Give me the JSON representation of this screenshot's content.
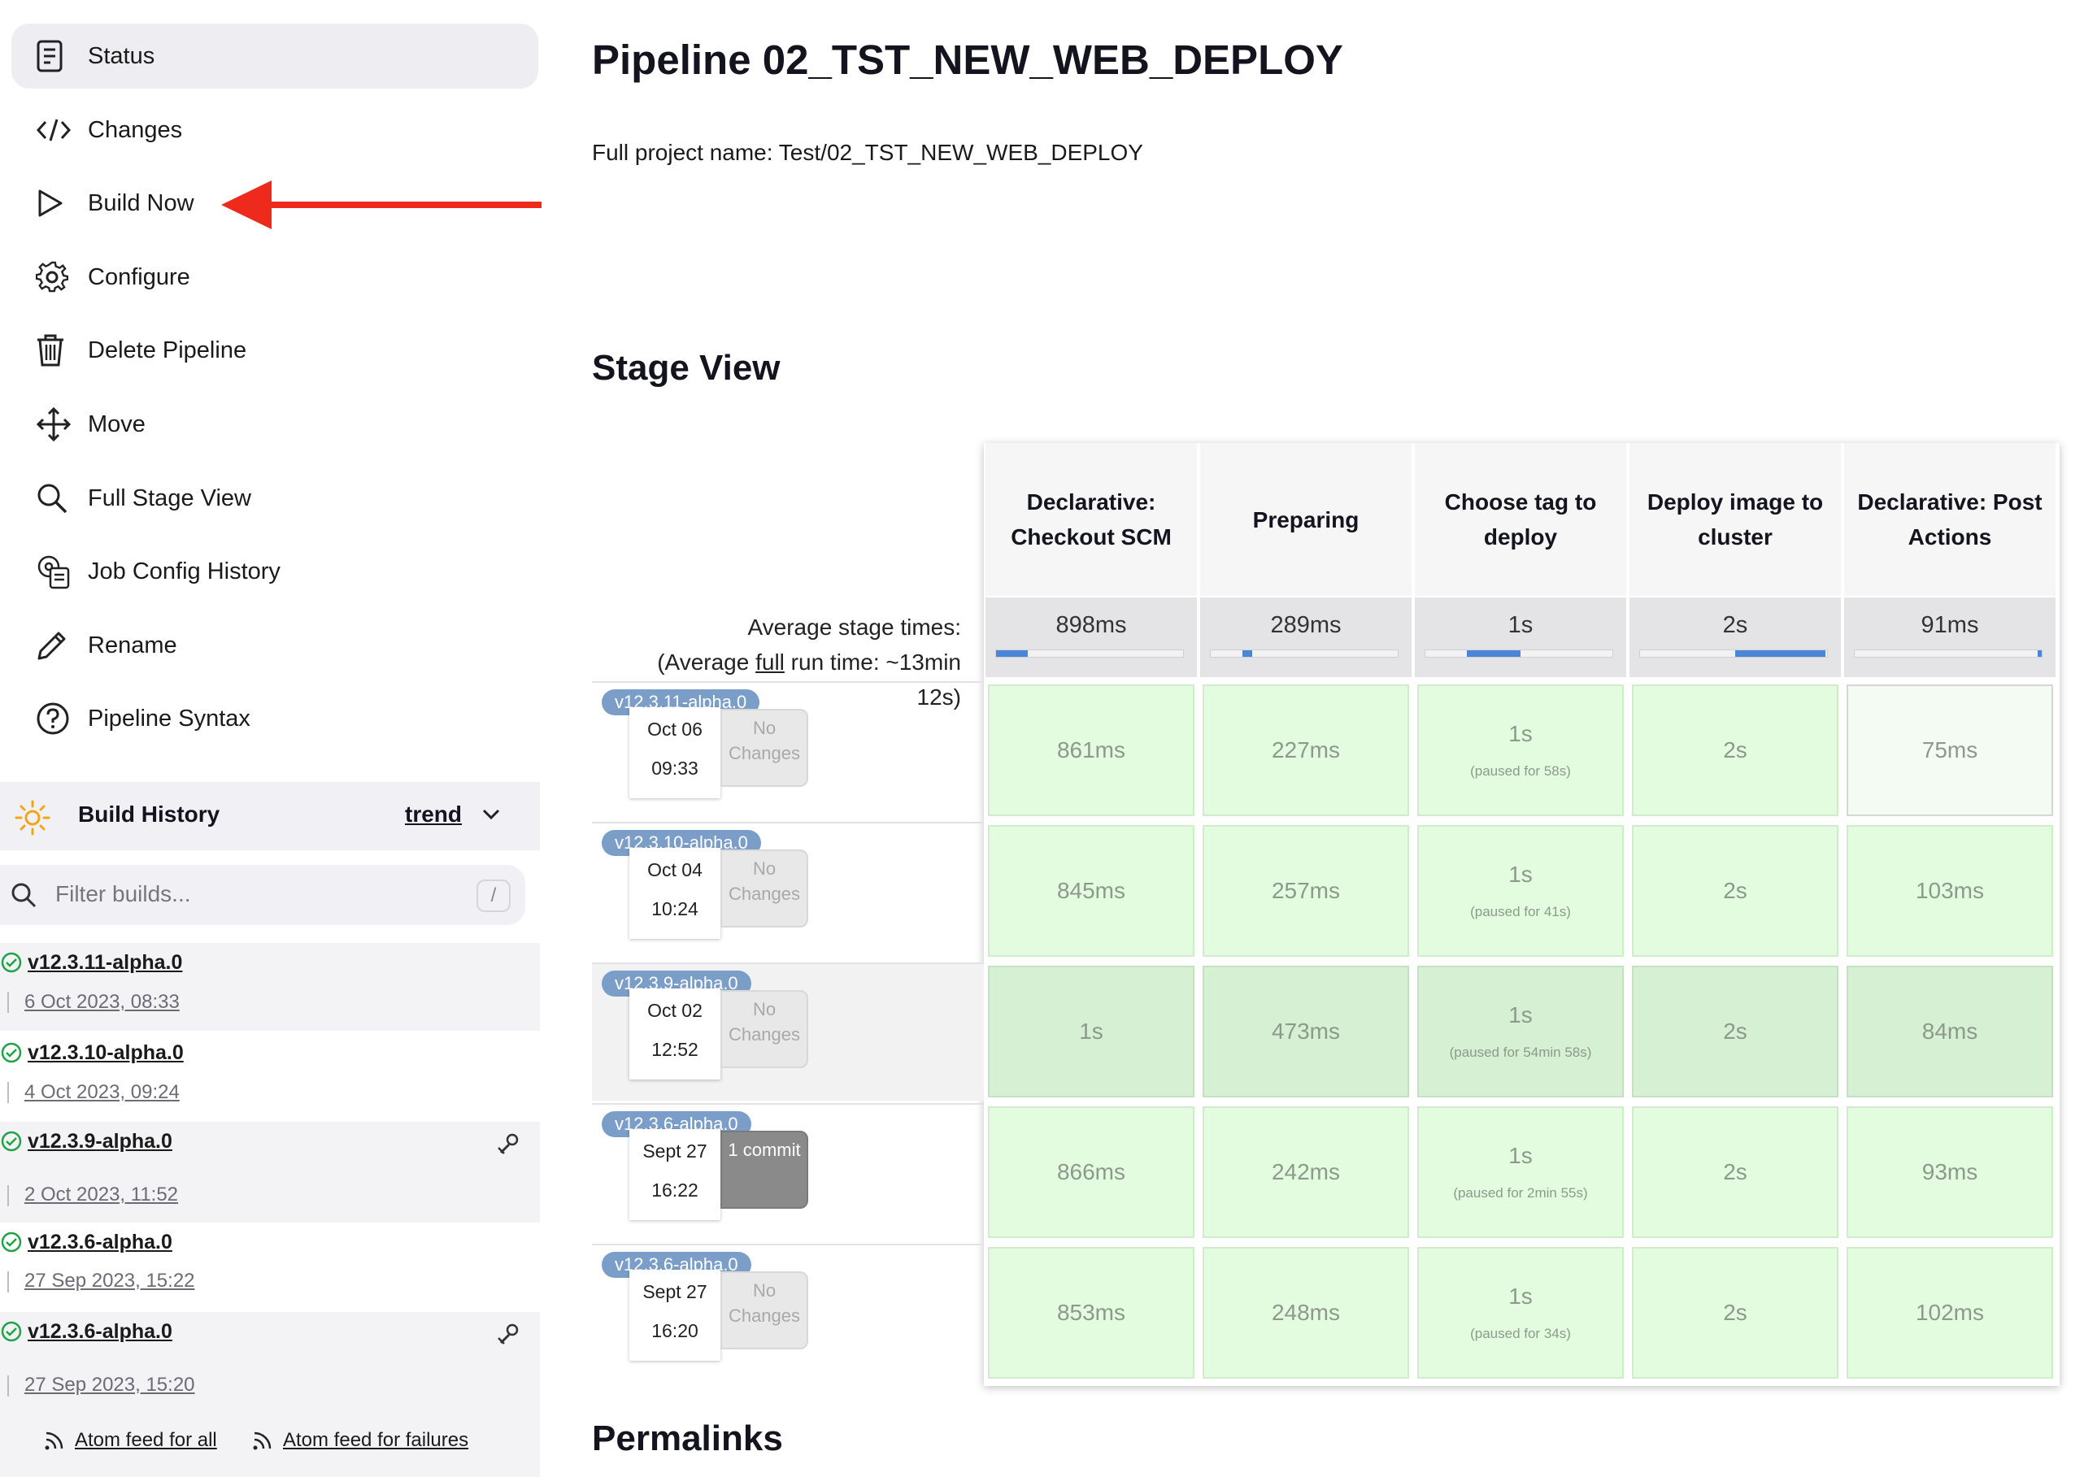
{
  "sidebar": {
    "tasks": [
      {
        "label": "Status",
        "icon": "status-icon",
        "active": true
      },
      {
        "label": "Changes",
        "icon": "code-icon"
      },
      {
        "label": "Build Now",
        "icon": "play-icon"
      },
      {
        "label": "Configure",
        "icon": "gear-icon"
      },
      {
        "label": "Delete Pipeline",
        "icon": "trash-icon"
      },
      {
        "label": "Move",
        "icon": "move-icon"
      },
      {
        "label": "Full Stage View",
        "icon": "search-icon"
      },
      {
        "label": "Job Config History",
        "icon": "history-icon"
      },
      {
        "label": "Rename",
        "icon": "pencil-icon"
      },
      {
        "label": "Pipeline Syntax",
        "icon": "help-icon"
      }
    ],
    "build_history": {
      "title": "Build History",
      "trend": "trend",
      "filter_placeholder": "Filter builds...",
      "filter_shortcut": "/",
      "builds": [
        {
          "name": "v12.3.11-alpha.0",
          "date": "6 Oct 2023, 08:33",
          "status": "success"
        },
        {
          "name": "v12.3.10-alpha.0",
          "date": "4 Oct 2023, 09:24",
          "status": "success"
        },
        {
          "name": "v12.3.9-alpha.0",
          "date": "2 Oct 2023, 11:52",
          "status": "success",
          "replayed": true
        },
        {
          "name": "v12.3.6-alpha.0",
          "date": "27 Sep 2023, 15:22",
          "status": "success"
        },
        {
          "name": "v12.3.6-alpha.0",
          "date": "27 Sep 2023, 15:20",
          "status": "success",
          "replayed": true
        }
      ],
      "feeds": {
        "all": "Atom feed for all",
        "failures": "Atom feed for failures"
      }
    }
  },
  "main": {
    "title": "Pipeline 02_TST_NEW_WEB_DEPLOY",
    "full_name": "Full project name: Test/02_TST_NEW_WEB_DEPLOY",
    "stage_view_heading": "Stage View",
    "permalinks_heading": "Permalinks"
  },
  "stage_view": {
    "avg_label_line1": "Average stage times:",
    "avg_label_line2_pre": "(Average ",
    "avg_label_link": "full",
    "avg_label_line2_post": " run time: ~13min",
    "avg_label_line3": "12s)",
    "columns": [
      {
        "name": "Declarative: Checkout SCM",
        "avg": "898ms",
        "avg_bar_start": 0.0,
        "avg_bar_fraction": 0.17
      },
      {
        "name": "Preparing",
        "avg": "289ms",
        "avg_bar_start": 0.17,
        "avg_bar_fraction": 0.05
      },
      {
        "name": "Choose tag to deploy",
        "avg": "1s",
        "avg_bar_start": 0.22,
        "avg_bar_fraction": 0.29
      },
      {
        "name": "Deploy image to cluster",
        "avg": "2s",
        "avg_bar_start": 0.51,
        "avg_bar_fraction": 0.48
      },
      {
        "name": "Declarative: Post Actions",
        "avg": "91ms",
        "avg_bar_start": 0.98,
        "avg_bar_fraction": 0.02
      }
    ],
    "runs": [
      {
        "tag": "v12.3.11-alpha.0",
        "date": "Oct 06",
        "time": "09:33",
        "changes": "No Changes",
        "commit": false,
        "cells": [
          {
            "v": "861ms"
          },
          {
            "v": "227ms"
          },
          {
            "v": "1s",
            "p": "(paused for 58s)"
          },
          {
            "v": "2s"
          },
          {
            "v": "75ms"
          }
        ]
      },
      {
        "tag": "v12.3.10-alpha.0",
        "date": "Oct 04",
        "time": "10:24",
        "changes": "No Changes",
        "commit": false,
        "cells": [
          {
            "v": "845ms"
          },
          {
            "v": "257ms"
          },
          {
            "v": "1s",
            "p": "(paused for 41s)"
          },
          {
            "v": "2s"
          },
          {
            "v": "103ms"
          }
        ]
      },
      {
        "tag": "v12.3.9-alpha.0",
        "date": "Oct 02",
        "time": "12:52",
        "changes": "No Changes",
        "commit": false,
        "cells": [
          {
            "v": "1s"
          },
          {
            "v": "473ms"
          },
          {
            "v": "1s",
            "p": "(paused for 54min 58s)"
          },
          {
            "v": "2s"
          },
          {
            "v": "84ms"
          }
        ]
      },
      {
        "tag": "v12.3.6-alpha.0",
        "date": "Sept 27",
        "time": "16:22",
        "changes": "1 commit",
        "commit": true,
        "cells": [
          {
            "v": "866ms"
          },
          {
            "v": "242ms"
          },
          {
            "v": "1s",
            "p": "(paused for 2min 55s)"
          },
          {
            "v": "2s"
          },
          {
            "v": "93ms"
          }
        ]
      },
      {
        "tag": "v12.3.6-alpha.0",
        "date": "Sept 27",
        "time": "16:20",
        "changes": "No Changes",
        "commit": false,
        "cells": [
          {
            "v": "853ms"
          },
          {
            "v": "248ms"
          },
          {
            "v": "1s",
            "p": "(paused for 34s)"
          },
          {
            "v": "2s"
          },
          {
            "v": "102ms"
          }
        ]
      }
    ]
  },
  "colors": {
    "annotation_arrow": "#ee2a1c",
    "success": "#1ea446",
    "tag": "#7b9ec9",
    "stage_cell": "#e3fce0"
  }
}
